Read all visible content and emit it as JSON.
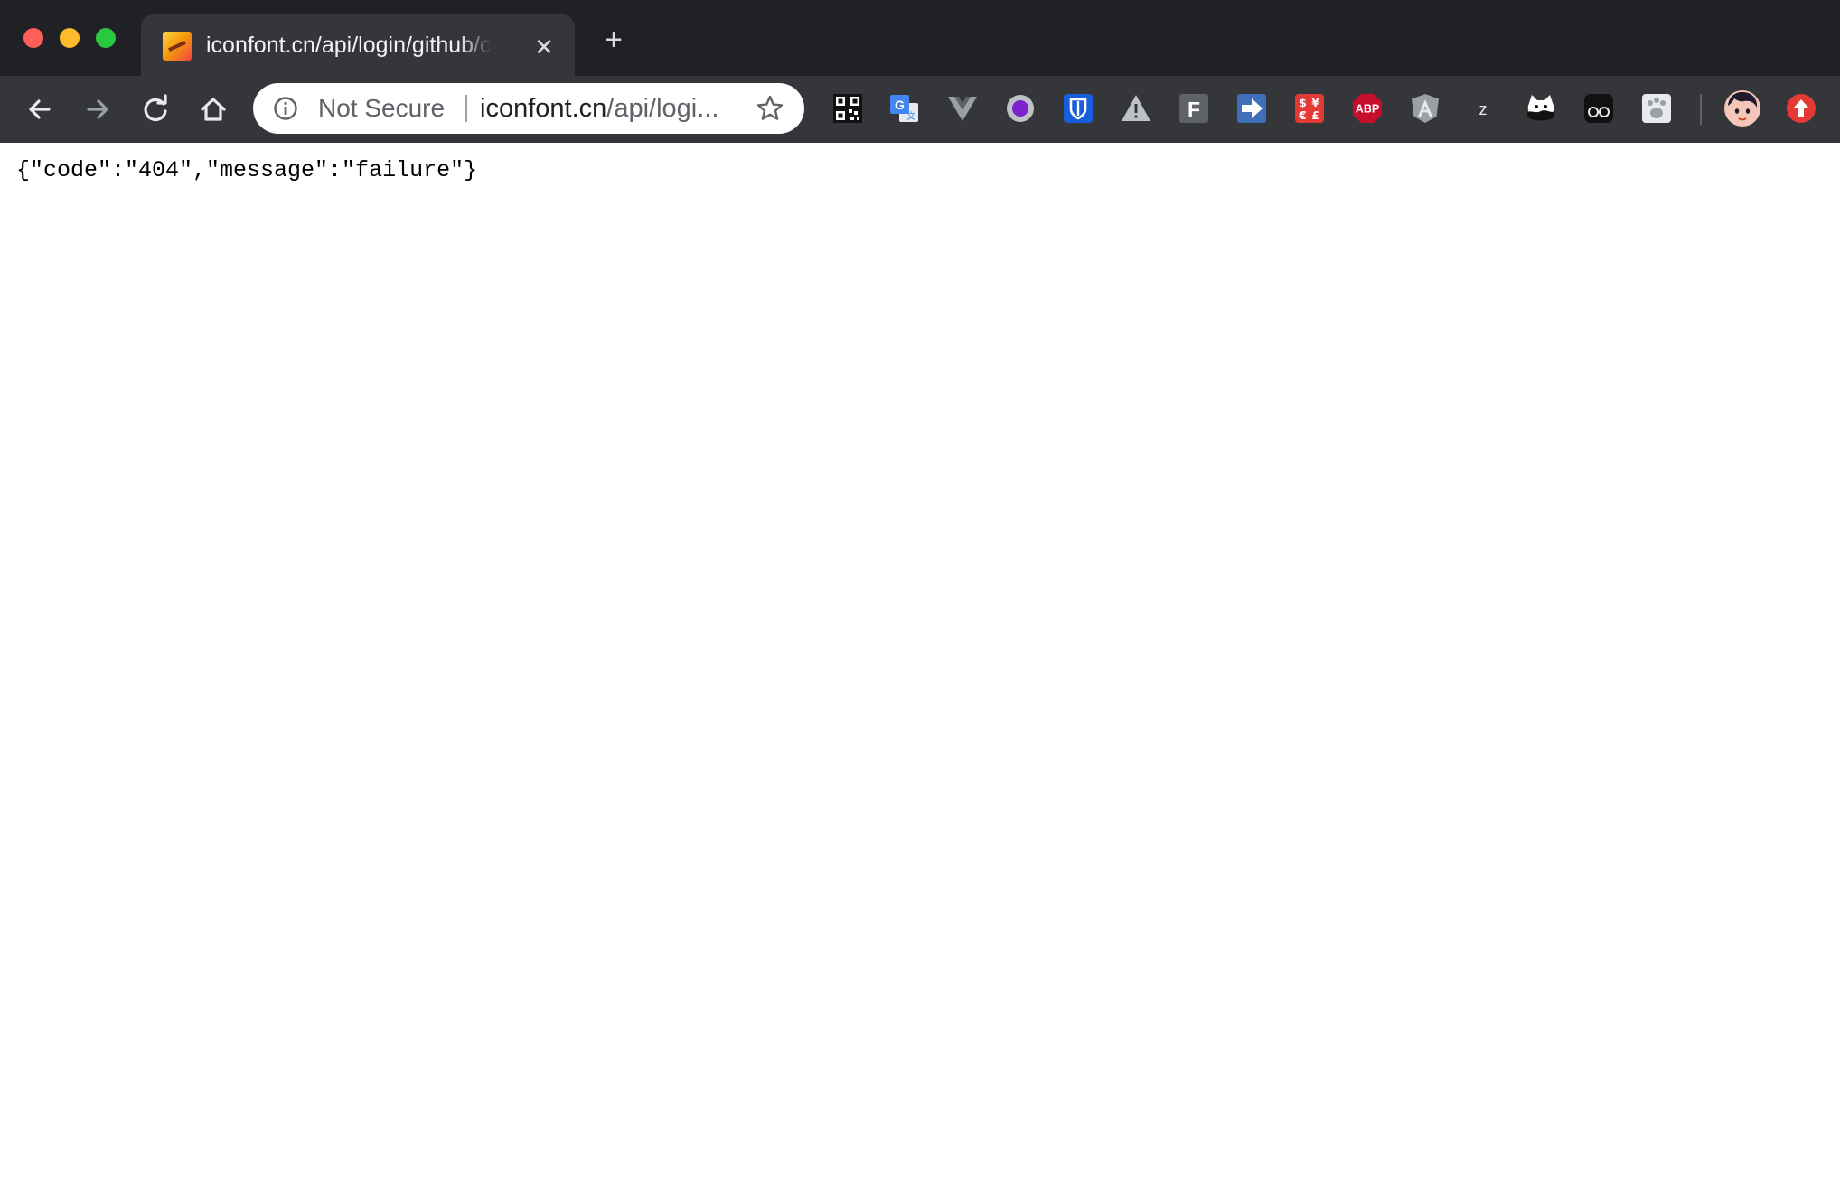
{
  "window": {
    "controls": [
      "close",
      "minimize",
      "maximize"
    ]
  },
  "tab": {
    "title": "iconfont.cn/api/login/github/ca",
    "favicon": "iconfont-favicon",
    "close_icon": "close-icon"
  },
  "new_tab_icon": "plus-icon",
  "toolbar": {
    "nav_icons": [
      "back-arrow-icon",
      "forward-arrow-icon",
      "reload-icon",
      "home-icon"
    ]
  },
  "omnibox": {
    "security_label": "Not Secure",
    "url_host": "iconfont.cn",
    "url_path": "/api/logi...",
    "bookmark_icon": "star-icon"
  },
  "extensions": [
    "qr-code-icon",
    "google-translate-icon",
    "vue-devtools-icon",
    "purple-circle-icon",
    "bitwarden-icon",
    "warning-icon",
    "f-extension-icon",
    "arrow-extension-icon",
    "currency-icon",
    "adblock-plus-icon",
    "angular-icon",
    "z-extension-icon",
    "cat-icon",
    "glasses-icon",
    "paw-icon",
    "profile-avatar",
    "update-icon"
  ],
  "colors": {
    "titlebar": "#202124",
    "toolbar": "#35363a",
    "close": "#fe5f57",
    "minimize": "#febb2e",
    "maximize": "#28c840"
  },
  "page": {
    "content": "{\"code\":\"404\",\"message\":\"failure\"}"
  }
}
